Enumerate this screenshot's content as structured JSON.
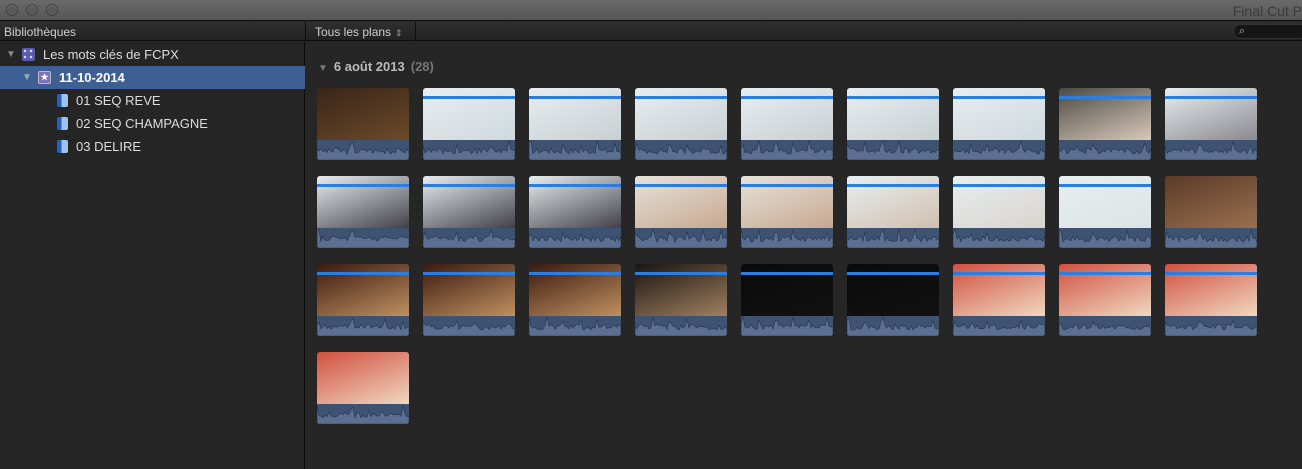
{
  "window": {
    "title": "Final Cut P"
  },
  "toolbar": {
    "libraries_label": "Bibliothèques",
    "filter_label": "Tous les plans",
    "search_placeholder": ""
  },
  "sidebar": {
    "library": "Les mots clés de FCPX",
    "event": "11-10-2014",
    "keywords": [
      "01 SEQ REVE",
      "02 SEQ CHAMPAGNE",
      "03 DELIRE"
    ]
  },
  "browser": {
    "date": "6 août 2013",
    "count": "(28)",
    "clips": [
      {
        "colors": [
          "#3a2518",
          "#6b4a2a"
        ],
        "blue": false
      },
      {
        "colors": [
          "#e8eef0",
          "#cfd9de"
        ],
        "blue": true
      },
      {
        "colors": [
          "#e8eef0",
          "#c8d0d4"
        ],
        "blue": true
      },
      {
        "colors": [
          "#e8eef0",
          "#c8d0d4"
        ],
        "blue": true
      },
      {
        "colors": [
          "#e8eef0",
          "#c8d0d4"
        ],
        "blue": true
      },
      {
        "colors": [
          "#e8eef0",
          "#c8d0d4"
        ],
        "blue": true
      },
      {
        "colors": [
          "#e8eef0",
          "#cfd9de"
        ],
        "blue": true
      },
      {
        "colors": [
          "#4a4a44",
          "#d8c8b8"
        ],
        "blue": true
      },
      {
        "colors": [
          "#e8eef0",
          "#8a8a90"
        ],
        "blue": true
      },
      {
        "colors": [
          "#e8eef0",
          "#40404a"
        ],
        "blue": true
      },
      {
        "colors": [
          "#e8eef0",
          "#40404a"
        ],
        "blue": true
      },
      {
        "colors": [
          "#e8eef0",
          "#40404a"
        ],
        "blue": true
      },
      {
        "colors": [
          "#e6e2da",
          "#c8a890"
        ],
        "blue": true
      },
      {
        "colors": [
          "#e6e2da",
          "#c8a890"
        ],
        "blue": true
      },
      {
        "colors": [
          "#e8eef0",
          "#d0c0b0"
        ],
        "blue": true
      },
      {
        "colors": [
          "#e8eef0",
          "#d8d4ce"
        ],
        "blue": true
      },
      {
        "colors": [
          "#e8eef0",
          "#dce4e6"
        ],
        "blue": true
      },
      {
        "colors": [
          "#5a3a28",
          "#9a7050"
        ],
        "blue": false
      },
      {
        "colors": [
          "#3a1a10",
          "#c09060"
        ],
        "blue": true
      },
      {
        "colors": [
          "#3a1a10",
          "#c09060"
        ],
        "blue": true
      },
      {
        "colors": [
          "#3a1a10",
          "#c09060"
        ],
        "blue": true
      },
      {
        "colors": [
          "#1a1410",
          "#a08060"
        ],
        "blue": true
      },
      {
        "colors": [
          "#0a0a0a",
          "#111111"
        ],
        "blue": true
      },
      {
        "colors": [
          "#0a0a0a",
          "#111111"
        ],
        "blue": true
      },
      {
        "colors": [
          "#d05040",
          "#f0d8c0"
        ],
        "blue": true
      },
      {
        "colors": [
          "#d05040",
          "#f0d8c0"
        ],
        "blue": true
      },
      {
        "colors": [
          "#d05040",
          "#f0d8c0"
        ],
        "blue": true
      },
      {
        "colors": [
          "#d05040",
          "#f0d8c0"
        ],
        "blue": false
      }
    ]
  }
}
